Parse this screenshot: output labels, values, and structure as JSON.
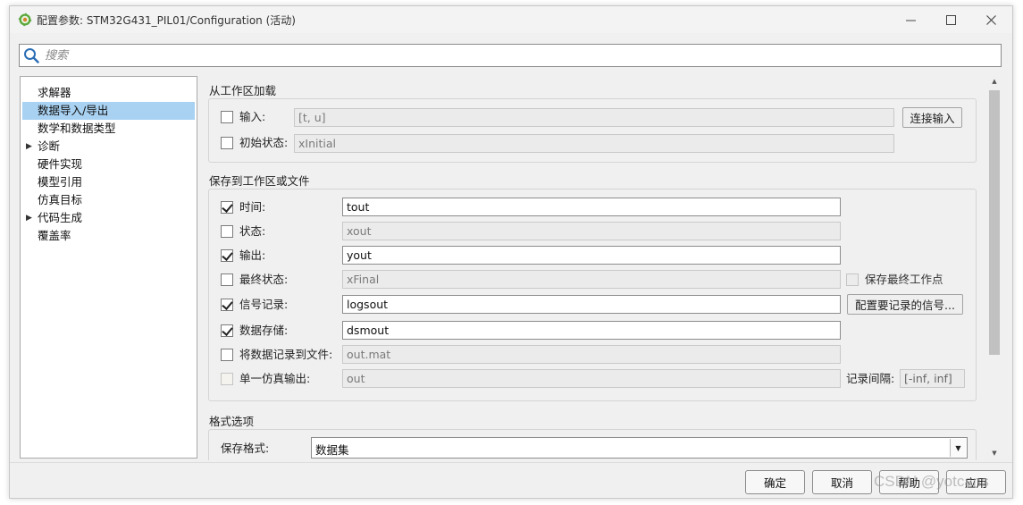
{
  "window": {
    "title": "配置参数: STM32G431_PIL01/Configuration (活动)",
    "icon": "simulink-gear-icon"
  },
  "search": {
    "placeholder": "搜索"
  },
  "nav": {
    "items": [
      {
        "label": "求解器",
        "selected": false,
        "expandable": false
      },
      {
        "label": "数据导入/导出",
        "selected": true,
        "expandable": false
      },
      {
        "label": "数学和数据类型",
        "selected": false,
        "expandable": false
      },
      {
        "label": "诊断",
        "selected": false,
        "expandable": true
      },
      {
        "label": "硬件实现",
        "selected": false,
        "expandable": false
      },
      {
        "label": "模型引用",
        "selected": false,
        "expandable": false
      },
      {
        "label": "仿真目标",
        "selected": false,
        "expandable": false
      },
      {
        "label": "代码生成",
        "selected": false,
        "expandable": true
      },
      {
        "label": "覆盖率",
        "selected": false,
        "expandable": false
      }
    ]
  },
  "load": {
    "title": "从工作区加载",
    "input": {
      "label": "输入:",
      "checked": false,
      "value": "[t, u]"
    },
    "initial": {
      "label": "初始状态:",
      "checked": false,
      "value": "xInitial"
    },
    "connect_button": "连接输入"
  },
  "save": {
    "title": "保存到工作区或文件",
    "rows": [
      {
        "label": "时间:",
        "checked": true,
        "enabled": true,
        "value": "tout"
      },
      {
        "label": "状态:",
        "checked": false,
        "enabled": true,
        "value": "xout"
      },
      {
        "label": "输出:",
        "checked": true,
        "enabled": true,
        "value": "yout"
      },
      {
        "label": "最终状态:",
        "checked": false,
        "enabled": true,
        "value": "xFinal"
      },
      {
        "label": "信号记录:",
        "checked": true,
        "enabled": true,
        "value": "logsout"
      },
      {
        "label": "数据存储:",
        "checked": true,
        "enabled": true,
        "value": "dsmout"
      },
      {
        "label": "将数据记录到文件:",
        "checked": false,
        "enabled": true,
        "value": "out.mat"
      },
      {
        "label": "单一仿真输出:",
        "checked": false,
        "enabled": false,
        "value": "out"
      }
    ],
    "save_final_op": {
      "label": "保存最终工作点",
      "checked": false
    },
    "config_signals_button": "配置要记录的信号...",
    "log_interval": {
      "label": "记录间隔:",
      "value": "[-inf, inf]"
    }
  },
  "format": {
    "title": "格式选项",
    "save_format_label": "保存格式:",
    "save_format_value": "数据集"
  },
  "footer": {
    "ok": "确定",
    "cancel": "取消",
    "help": "帮助",
    "apply": "应用"
  },
  "watermark": "CSDN @yotcans"
}
